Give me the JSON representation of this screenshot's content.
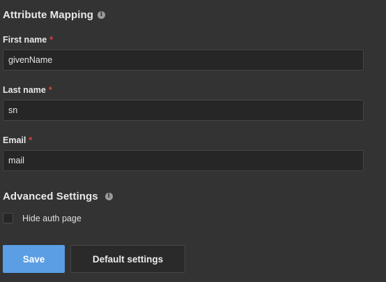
{
  "attribute_mapping": {
    "title": "Attribute Mapping",
    "info_icon": "info-icon",
    "fields": [
      {
        "label": "First name",
        "required_mark": "*",
        "value": "givenName"
      },
      {
        "label": "Last name",
        "required_mark": "*",
        "value": "sn"
      },
      {
        "label": "Email",
        "required_mark": "*",
        "value": "mail"
      }
    ]
  },
  "advanced_settings": {
    "title": "Advanced Settings",
    "info_icon": "info-icon",
    "hide_auth_page": {
      "label": "Hide auth page",
      "checked": false
    }
  },
  "actions": {
    "save_label": "Save",
    "default_settings_label": "Default settings"
  },
  "colors": {
    "background": "#333333",
    "input_background": "#262626",
    "primary": "#5b9ee3",
    "required": "#e0413b"
  }
}
